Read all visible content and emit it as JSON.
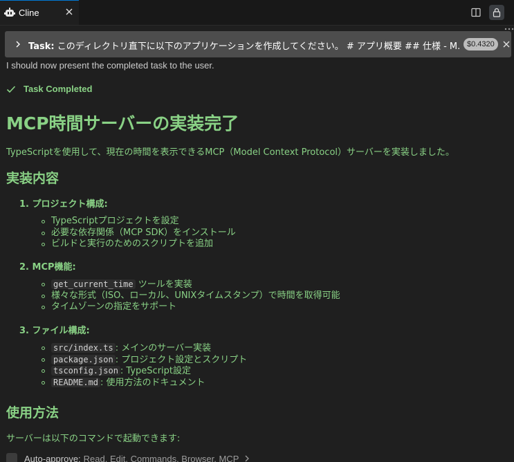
{
  "tab": {
    "title": "Cline"
  },
  "task": {
    "label": "Task:",
    "text": "このディレクトリ直下に以下のアプリケーションを作成してください。 # アプリ概要 ## 仕様 - M...",
    "cost": "$0.4320"
  },
  "message": {
    "truncated_line": "I should now present the completed task to the user.",
    "completed_label": "Task Completed",
    "title": "MCP時間サーバーの実装完了",
    "intro": "TypeScriptを使用して、現在の時間を表示できるMCP（Model Context Protocol）サーバーを実装しました。",
    "h2_impl": "実装内容",
    "sections": [
      {
        "title": "1. プロジェクト構成:",
        "items": [
          {
            "text": "TypeScriptプロジェクトを設定"
          },
          {
            "text": "必要な依存関係（MCP SDK）をインストール"
          },
          {
            "text": "ビルドと実行のためのスクリプトを追加"
          }
        ]
      },
      {
        "title": "2. MCP機能:",
        "items": [
          {
            "code": "get_current_time",
            "text": " ツールを実装"
          },
          {
            "text": "様々な形式（ISO、ローカル、UNIXタイムスタンプ）で時間を取得可能"
          },
          {
            "text": "タイムゾーンの指定をサポート"
          }
        ]
      },
      {
        "title": "3. ファイル構成:",
        "items": [
          {
            "code": "src/index.ts",
            "text": ": メインのサーバー実装"
          },
          {
            "code": "package.json",
            "text": ": プロジェクト設定とスクリプト"
          },
          {
            "code": "tsconfig.json",
            "text": ": TypeScript設定"
          },
          {
            "code": "README.md",
            "text": ": 使用方法のドキュメント"
          }
        ]
      }
    ],
    "h2_usage": "使用方法",
    "usage_text": "サーバーは以下のコマンドで起動できます:"
  },
  "auto_approve": {
    "label": "Auto-approve:",
    "list": "Read, Edit, Commands, Browser, MCP"
  },
  "colors": {
    "accent": "#89d185",
    "background": "#1f1f1f",
    "header": "#4d4d4d"
  }
}
